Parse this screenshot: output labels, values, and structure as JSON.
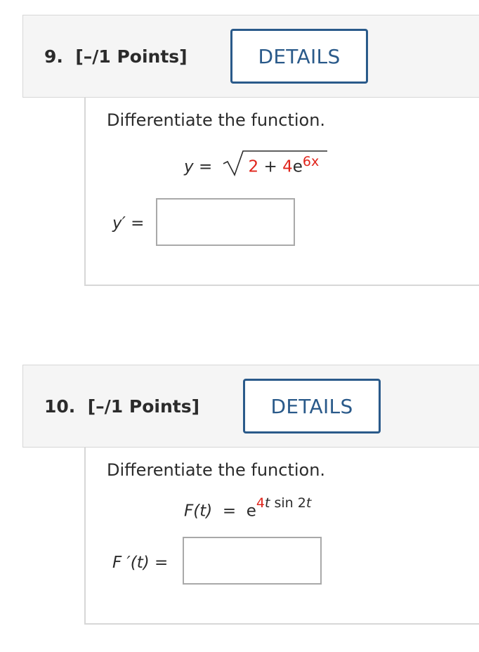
{
  "questions": [
    {
      "number_label": "9.",
      "points_label": "[–/1 Points]",
      "details_label": "DETAILS",
      "prompt": "Differentiate the function.",
      "equation": {
        "lhs": "y",
        "equals": "=",
        "radicand_constant": "2",
        "plus": "+",
        "coefficient": "4",
        "base": "e",
        "exponent": "6x"
      },
      "answer_label": "y′ =",
      "answer_value": ""
    },
    {
      "number_label": "10.",
      "points_label": "[–/1 Points]",
      "details_label": "DETAILS",
      "prompt": "Differentiate the function.",
      "equation": {
        "lhs": "F(t)",
        "equals": "=",
        "base": "e",
        "exponent_coefficient": "4",
        "exponent_var": "t",
        "exponent_func": "sin 2",
        "exponent_var2": "t"
      },
      "answer_label": "F ′(t) =",
      "answer_value": ""
    }
  ],
  "colors": {
    "accent": "#2a5a8a",
    "highlight": "#e0241b",
    "header_bg": "#f5f5f5"
  }
}
